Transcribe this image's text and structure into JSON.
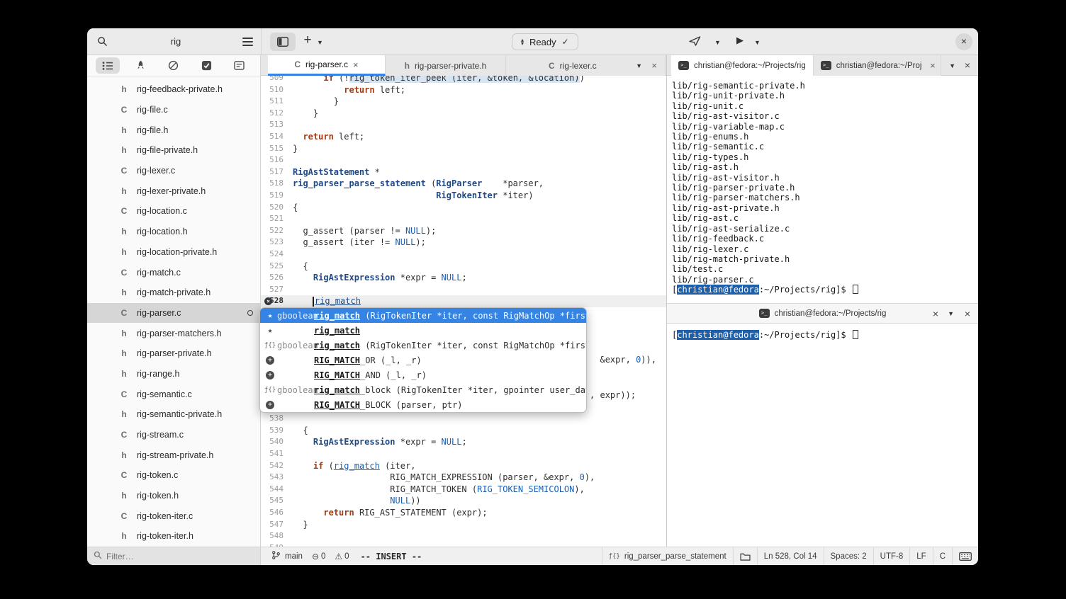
{
  "icons": {
    "plus": "+",
    "chevron_down": "▼",
    "play": "▶",
    "close": "×",
    "check": "✓",
    "star": "★",
    "func": "ƒ{}",
    "warning": "⚠",
    "error": "⊖",
    "sort_up": "▴",
    "sort_down": "▾",
    "terminal_glyph": ">_"
  },
  "header": {
    "ready_label": "Ready"
  },
  "sidebar": {
    "search_query": "rig",
    "filter_placeholder": "Filter…",
    "files": [
      {
        "type": "h",
        "name": "rig-feedback-private.h"
      },
      {
        "type": "C",
        "name": "rig-file.c"
      },
      {
        "type": "h",
        "name": "rig-file.h"
      },
      {
        "type": "h",
        "name": "rig-file-private.h"
      },
      {
        "type": "C",
        "name": "rig-lexer.c"
      },
      {
        "type": "h",
        "name": "rig-lexer-private.h"
      },
      {
        "type": "C",
        "name": "rig-location.c"
      },
      {
        "type": "h",
        "name": "rig-location.h"
      },
      {
        "type": "h",
        "name": "rig-location-private.h"
      },
      {
        "type": "C",
        "name": "rig-match.c"
      },
      {
        "type": "h",
        "name": "rig-match-private.h"
      },
      {
        "type": "C",
        "name": "rig-parser.c",
        "selected": true,
        "modified": true
      },
      {
        "type": "h",
        "name": "rig-parser-matchers.h"
      },
      {
        "type": "h",
        "name": "rig-parser-private.h"
      },
      {
        "type": "h",
        "name": "rig-range.h"
      },
      {
        "type": "C",
        "name": "rig-semantic.c"
      },
      {
        "type": "h",
        "name": "rig-semantic-private.h"
      },
      {
        "type": "C",
        "name": "rig-stream.c"
      },
      {
        "type": "h",
        "name": "rig-stream-private.h"
      },
      {
        "type": "C",
        "name": "rig-token.c"
      },
      {
        "type": "h",
        "name": "rig-token.h"
      },
      {
        "type": "C",
        "name": "rig-token-iter.c"
      },
      {
        "type": "h",
        "name": "rig-token-iter.h"
      }
    ]
  },
  "editor": {
    "tabs": [
      {
        "lang": "C",
        "name": "rig-parser.c"
      },
      {
        "lang": "h",
        "name": "rig-parser-private.h"
      },
      {
        "lang": "C",
        "name": "rig-lexer.c"
      }
    ],
    "lines": [
      {
        "n": 509,
        "seg": [
          [
            "p",
            "      "
          ],
          [
            "k",
            "if"
          ],
          [
            "p",
            " (!"
          ],
          [
            "hl",
            "rig_token_iter_peek (iter, &token, &location)"
          ],
          [
            "p",
            ")"
          ]
        ]
      },
      {
        "n": 510,
        "seg": [
          [
            "p",
            "          "
          ],
          [
            "k",
            "return"
          ],
          [
            "p",
            " left;"
          ]
        ]
      },
      {
        "n": 511,
        "seg": [
          [
            "p",
            "        }"
          ]
        ]
      },
      {
        "n": 512,
        "seg": [
          [
            "p",
            "    }"
          ]
        ]
      },
      {
        "n": 513,
        "seg": []
      },
      {
        "n": 514,
        "seg": [
          [
            "p",
            "  "
          ],
          [
            "k",
            "return"
          ],
          [
            "p",
            " left;"
          ]
        ]
      },
      {
        "n": 515,
        "seg": [
          [
            "p",
            "}"
          ]
        ]
      },
      {
        "n": 516,
        "seg": []
      },
      {
        "n": 517,
        "seg": [
          [
            "t",
            "RigAstStatement"
          ],
          [
            "p",
            " *"
          ]
        ]
      },
      {
        "n": 518,
        "seg": [
          [
            "t",
            "rig_parser_parse_statement"
          ],
          [
            "p",
            " ("
          ],
          [
            "t",
            "RigParser"
          ],
          [
            "p",
            "    *parser,"
          ]
        ]
      },
      {
        "n": 519,
        "seg": [
          [
            "p",
            "                            "
          ],
          [
            "t",
            "RigTokenIter"
          ],
          [
            "p",
            " *iter)"
          ]
        ]
      },
      {
        "n": 520,
        "seg": [
          [
            "p",
            "{"
          ]
        ]
      },
      {
        "n": 521,
        "seg": []
      },
      {
        "n": 522,
        "seg": [
          [
            "p",
            "  g_assert (parser != "
          ],
          [
            "c",
            "NULL"
          ],
          [
            "p",
            ");"
          ]
        ]
      },
      {
        "n": 523,
        "seg": [
          [
            "p",
            "  g_assert (iter != "
          ],
          [
            "c",
            "NULL"
          ],
          [
            "p",
            ");"
          ]
        ]
      },
      {
        "n": 524,
        "seg": []
      },
      {
        "n": 525,
        "seg": [
          [
            "p",
            "  {"
          ]
        ]
      },
      {
        "n": 526,
        "seg": [
          [
            "p",
            "    "
          ],
          [
            "t",
            "RigAstExpression"
          ],
          [
            "p",
            " *expr = "
          ],
          [
            "c",
            "NULL"
          ],
          [
            "p",
            ";"
          ]
        ]
      },
      {
        "n": 527,
        "seg": []
      },
      {
        "n": 528,
        "current": true,
        "badge": true,
        "seg": [
          [
            "p",
            "    "
          ],
          [
            "caret",
            ""
          ],
          [
            "u",
            "rig_match"
          ]
        ]
      },
      {
        "n": 529,
        "seg": []
      },
      {
        "n": 530,
        "seg": []
      },
      {
        "n": 531,
        "seg": []
      },
      {
        "n": 532,
        "seg": []
      },
      {
        "n": 533,
        "seg": [
          [
            "p",
            "                                                            &expr, "
          ],
          [
            "c",
            "0"
          ],
          [
            "p",
            ")),"
          ]
        ]
      },
      {
        "n": 534,
        "seg": []
      },
      {
        "n": 535,
        "seg": []
      },
      {
        "n": 536,
        "seg": [
          [
            "p",
            "                                                          , expr));"
          ]
        ]
      },
      {
        "n": 537,
        "seg": []
      },
      {
        "n": 538,
        "seg": []
      },
      {
        "n": 539,
        "seg": [
          [
            "p",
            "  {"
          ]
        ]
      },
      {
        "n": 540,
        "seg": [
          [
            "p",
            "    "
          ],
          [
            "t",
            "RigAstExpression"
          ],
          [
            "p",
            " *expr = "
          ],
          [
            "c",
            "NULL"
          ],
          [
            "p",
            ";"
          ]
        ]
      },
      {
        "n": 541,
        "seg": []
      },
      {
        "n": 542,
        "seg": [
          [
            "p",
            "    "
          ],
          [
            "k",
            "if"
          ],
          [
            "p",
            " ("
          ],
          [
            "f",
            "rig_match"
          ],
          [
            "p",
            " (iter,"
          ]
        ]
      },
      {
        "n": 543,
        "seg": [
          [
            "p",
            "                   RIG_MATCH_EXPRESSION (parser, &expr, "
          ],
          [
            "c",
            "0"
          ],
          [
            "p",
            "),"
          ]
        ]
      },
      {
        "n": 544,
        "seg": [
          [
            "p",
            "                   RIG_MATCH_TOKEN ("
          ],
          [
            "c",
            "RIG_TOKEN_SEMICOLON"
          ],
          [
            "p",
            "),"
          ]
        ]
      },
      {
        "n": 545,
        "seg": [
          [
            "p",
            "                   "
          ],
          [
            "c",
            "NULL"
          ],
          [
            "p",
            "))"
          ]
        ]
      },
      {
        "n": 546,
        "seg": [
          [
            "p",
            "      "
          ],
          [
            "k",
            "return"
          ],
          [
            "p",
            " RIG_AST_STATEMENT (expr);"
          ]
        ]
      },
      {
        "n": 547,
        "seg": [
          [
            "p",
            "  }"
          ]
        ]
      },
      {
        "n": 548,
        "seg": []
      },
      {
        "n": 549,
        "seg": []
      }
    ]
  },
  "popup": {
    "rows": [
      {
        "icon": "star",
        "ret": "gboolean",
        "name": "rig_match",
        "rest": " (RigTokenIter *iter, const RigMatchOp *first_op, ...)",
        "selected": true
      },
      {
        "icon": "star",
        "ret": "",
        "name": "rig_match",
        "rest": ""
      },
      {
        "icon": "func",
        "ret": "gboolean",
        "name": "rig_match",
        "rest": " (RigTokenIter *iter, const RigMatchOp *first_op, ...)"
      },
      {
        "icon": "plus",
        "ret": "",
        "name": "RIG_MATCH",
        "rest": "_OR (_l, _r)"
      },
      {
        "icon": "plus",
        "ret": "",
        "name": "RIG_MATCH",
        "rest": "_AND (_l, _r)"
      },
      {
        "icon": "func",
        "ret": "gboolean",
        "name": "rig_match",
        "rest": "_block (RigTokenIter *iter, gpointer user_data)"
      },
      {
        "icon": "plus",
        "ret": "",
        "name": "RIG_MATCH",
        "rest": "_BLOCK (parser, ptr)"
      }
    ]
  },
  "terminal": {
    "tab1_title": "christian@fedora:~/Projects/rig",
    "tab2_title": "christian@fedora:~/Projects",
    "pane2_title": "christian@fedora:~/Projects/rig",
    "t1_lines": [
      "lib/rig-semantic-private.h",
      "lib/rig-unit-private.h",
      "lib/rig-unit.c",
      "lib/rig-ast-visitor.c",
      "lib/rig-variable-map.c",
      "lib/rig-enums.h",
      "lib/rig-semantic.c",
      "lib/rig-types.h",
      "lib/rig-ast.h",
      "lib/rig-ast-visitor.h",
      "lib/rig-parser-private.h",
      "lib/rig-parser-matchers.h",
      "lib/rig-ast-private.h",
      "lib/rig-ast.c",
      "lib/rig-ast-serialize.c",
      "lib/rig-feedback.c",
      "lib/rig-lexer.c",
      "lib/rig-match-private.h",
      "lib/test.c",
      "lib/rig-parser.c"
    ],
    "prompt": {
      "open": "[",
      "user": "christian@fedora",
      "rest": ":~/Projects/rig]$"
    }
  },
  "statusbar": {
    "branch": "main",
    "errors": "0",
    "warnings": "0",
    "mode": "-- INSERT --",
    "symbol": "rig_parser_parse_statement",
    "position": "Ln 528, Col 14",
    "spaces": "Spaces: 2",
    "encoding": "UTF-8",
    "line_ending": "LF",
    "language": "C"
  }
}
